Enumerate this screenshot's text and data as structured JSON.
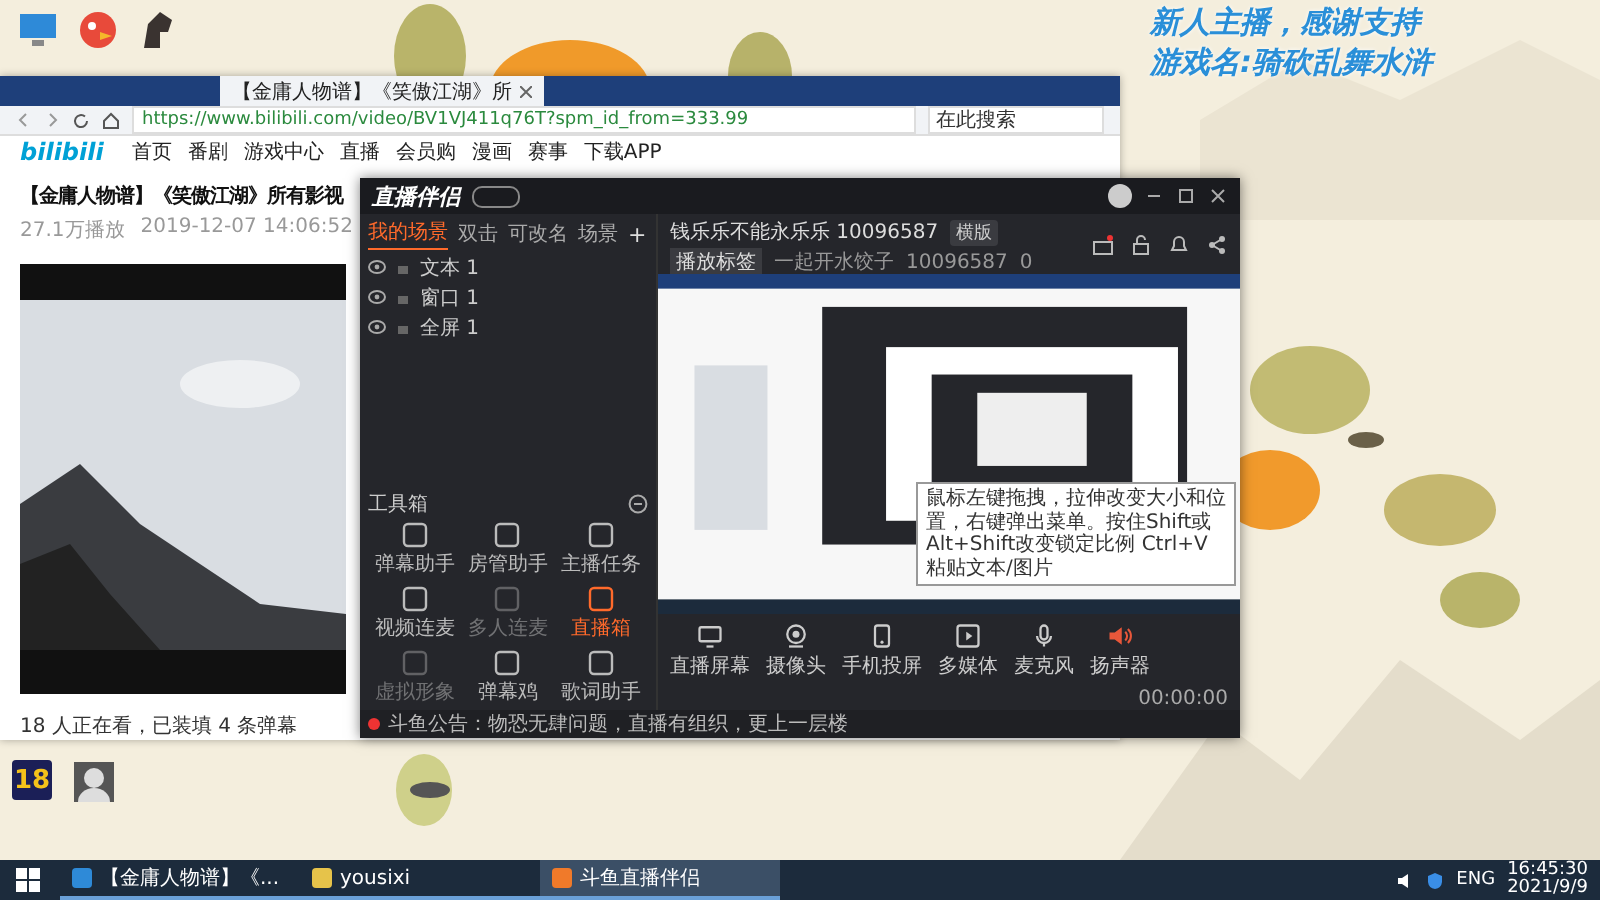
{
  "overlay": {
    "lines": [
      "新人主播，感谢支持",
      "游戏名:骑砍乱舞水浒"
    ]
  },
  "desktop": {
    "badge": "18"
  },
  "browser": {
    "tab": {
      "title": "【金庸人物谱】《笑傲江湖》所",
      "selected": true
    },
    "address": "https://www.bilibili.com/video/BV1VJ411q76T?spm_id_from=333.99",
    "search": {
      "placeholder": "在此搜索"
    },
    "logo": "bilibili",
    "nav": [
      "首页",
      "番剧",
      "游戏中心",
      "直播",
      "会员购",
      "漫画",
      "赛事",
      "下载APP"
    ],
    "video_title": "【金庸人物谱】《笑傲江湖》所有影视",
    "views": "27.1万播放",
    "date": "2019-12-07 14:06:52",
    "viewers": "18 人正在看，已装填 4 条弹幕"
  },
  "app": {
    "logo": "直播伴侣",
    "scene_tabs": [
      {
        "label": "我的场景",
        "selected": true
      },
      {
        "label": "双击",
        "selected": false
      },
      {
        "label": "可改名",
        "selected": false
      },
      {
        "label": "场景",
        "selected": false
      }
    ],
    "add": "+",
    "sources": [
      "文本 1",
      "窗口 1",
      "全屏 1"
    ],
    "room_title": "钱乐乐不能永乐乐 10096587",
    "orientation": "横版",
    "tag_button": "播放标签",
    "category": "一起开水饺子",
    "room_id": "10096587",
    "heat": "0",
    "toolbox": "工具箱",
    "tools": [
      {
        "label": "弹幕助手",
        "active": false,
        "disabled": false
      },
      {
        "label": "房管助手",
        "active": false,
        "disabled": false
      },
      {
        "label": "主播任务",
        "active": false,
        "disabled": false
      },
      {
        "label": "视频连麦",
        "active": false,
        "disabled": false
      },
      {
        "label": "多人连麦",
        "active": false,
        "disabled": true
      },
      {
        "label": "直播箱",
        "active": true,
        "disabled": false
      },
      {
        "label": "虚拟形象",
        "active": false,
        "disabled": true
      },
      {
        "label": "弹幕鸡",
        "active": false,
        "disabled": false
      },
      {
        "label": "歌词助手",
        "active": false,
        "disabled": false
      }
    ],
    "notice": "斗鱼公告：物恐无肆问题，直播有组织，更上一层楼",
    "controls": [
      {
        "kind": "monitor",
        "label": "直播屏幕"
      },
      {
        "kind": "camera",
        "label": "摄像头"
      },
      {
        "kind": "phone",
        "label": "手机投屏"
      },
      {
        "kind": "media",
        "label": "多媒体"
      },
      {
        "kind": "mic",
        "label": "麦克风"
      },
      {
        "kind": "speaker",
        "label": "扬声器"
      }
    ],
    "tooltip": "鼠标左键拖拽，拉伸改变大小和位置，右键弹出菜单。按住Shift或Alt+Shift改变锁定比例 Ctrl+V粘贴文本/图片",
    "timer": "00:00:00"
  },
  "taskbar": {
    "items": [
      {
        "label": "【金庸人物谱】《...",
        "selected": false
      },
      {
        "label": "yousixi",
        "selected": false
      },
      {
        "label": "斗鱼直播伴侣",
        "selected": true
      }
    ],
    "language": "ENG",
    "time": "16:45:30",
    "date": "2021/9/9"
  }
}
